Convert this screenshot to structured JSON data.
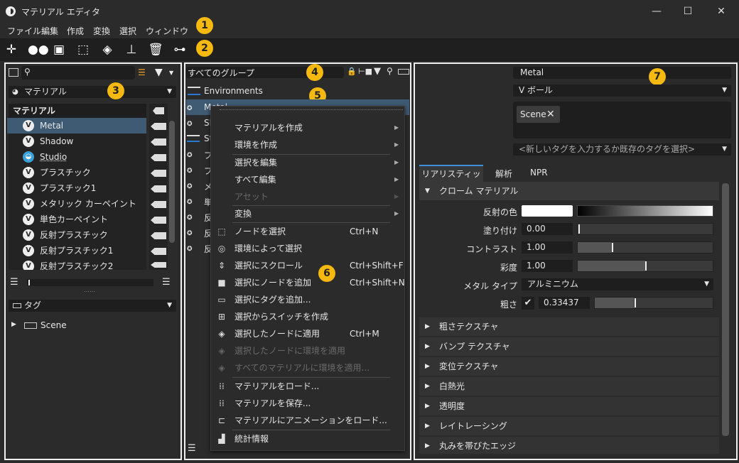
{
  "window": {
    "title": "マテリアル エディタ"
  },
  "menu": [
    "ファイル",
    "編集",
    "作成",
    "変換",
    "選択",
    "ウィンドウ"
  ],
  "badges": [
    "1",
    "2",
    "3",
    "4",
    "5",
    "6",
    "7"
  ],
  "left": {
    "filter_label": "マテリアル",
    "tree_header": "マテリアル",
    "items": [
      "Metal",
      "Shadow",
      "Studio",
      "プラスチック",
      "プラスチック1",
      "メタリック カーペイント",
      "単色カーペイント",
      "反射プラスチック",
      "反射プラスチック1",
      "反射プラスチック2"
    ],
    "tag_label": "タグ",
    "tag_item": "Scene"
  },
  "middle": {
    "group_label": "すべてのグループ",
    "rows": [
      "Environments",
      "Metal",
      "Sh",
      "St",
      "プ",
      "プ",
      "メ",
      "単",
      "反",
      "反",
      "反"
    ]
  },
  "context_menu": [
    {
      "label": "マテリアルを作成",
      "sub": true
    },
    {
      "label": "環境を作成",
      "sub": true
    },
    {
      "label": "選択を編集",
      "sub": true
    },
    {
      "label": "すべて編集",
      "sub": true
    },
    {
      "label": "アセット",
      "sub": true,
      "disabled": true
    },
    {
      "label": "変換",
      "sub": true
    },
    {
      "label": "ノードを選択",
      "shortcut": "Ctrl+N"
    },
    {
      "label": "環境によって選択"
    },
    {
      "label": "選択にスクロール",
      "shortcut": "Ctrl+Shift+F"
    },
    {
      "label": "選択にノードを追加",
      "shortcut": "Ctrl+Shift+N"
    },
    {
      "label": "選択にタグを追加..."
    },
    {
      "label": "選択からスイッチを作成"
    },
    {
      "label": "選択したノードに適用",
      "shortcut": "Ctrl+M"
    },
    {
      "label": "選択したノードに環境を適用",
      "disabled": true
    },
    {
      "label": "すべてのマテリアルに環境を適用...",
      "disabled": true
    },
    {
      "label": "マテリアルをロード..."
    },
    {
      "label": "マテリアルを保存..."
    },
    {
      "label": "マテリアルにアニメーションをロード..."
    },
    {
      "label": "統計情報"
    }
  ],
  "right": {
    "name": "Metal",
    "type": "V ボール",
    "tag_chip": "Scene",
    "tag_placeholder": "<新しいタグを入力するか既存のタグを選択>",
    "tabs": [
      "リアリスティック",
      "解析",
      "NPR"
    ],
    "section_open": "クローム マテリアル",
    "props": {
      "reflect_color": "反射の色",
      "paint": "塗り付け",
      "paint_value": "0.00",
      "contrast": "コントラスト",
      "contrast_value": "1.00",
      "saturation": "彩度",
      "saturation_value": "1.00",
      "metal_type": "メタル タイプ",
      "metal_type_value": "アルミニウム",
      "roughness": "粗さ",
      "roughness_value": "0.33437"
    },
    "sections": [
      "粗さテクスチャ",
      "バンプ テクスチャ",
      "変位テクスチャ",
      "白熱光",
      "透明度",
      "レイトレーシング",
      "丸みを帯びたエッジ"
    ]
  }
}
